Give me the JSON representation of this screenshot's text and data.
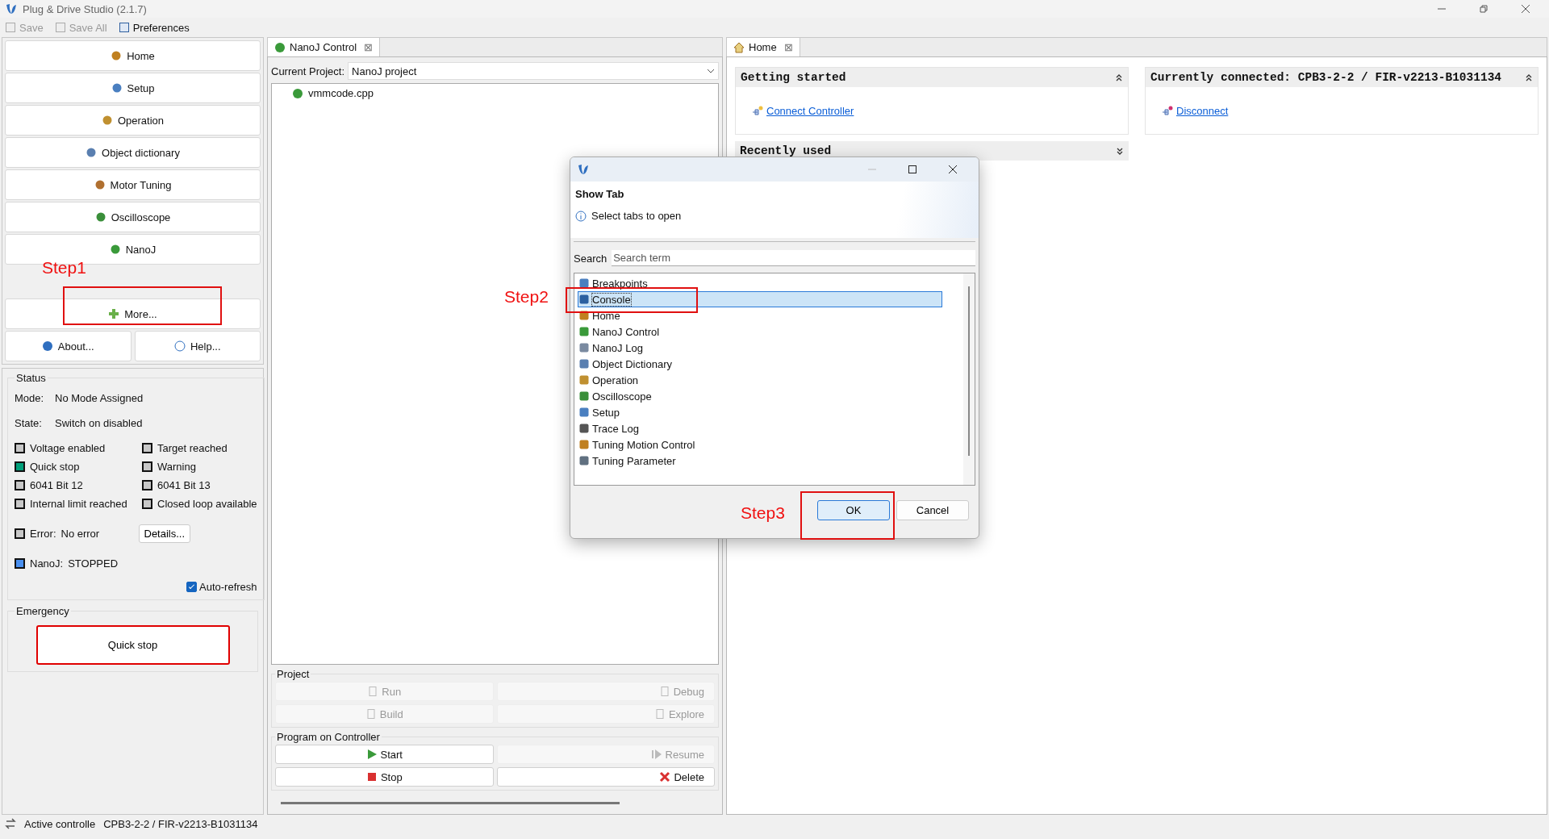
{
  "window": {
    "title": "Plug & Drive Studio (2.1.7)"
  },
  "toolbar": [
    {
      "label": "Save",
      "disabled": true
    },
    {
      "label": "Save All",
      "disabled": true
    },
    {
      "label": "Preferences",
      "disabled": false
    }
  ],
  "sidebar": {
    "nav": [
      {
        "label": "Home"
      },
      {
        "label": "Setup"
      },
      {
        "label": "Operation"
      },
      {
        "label": "Object dictionary"
      },
      {
        "label": "Motor Tuning"
      },
      {
        "label": "Oscilloscope"
      },
      {
        "label": "NanoJ"
      }
    ],
    "more": {
      "label": "More..."
    },
    "about": {
      "label": "About..."
    },
    "help": {
      "label": "Help..."
    },
    "status": {
      "title": "Status",
      "mode_label": "Mode:",
      "mode": "No Mode Assigned",
      "state_label": "State:",
      "state": "Switch on disabled",
      "indicators": [
        {
          "label": "Voltage enabled",
          "color": "#c8c8c8"
        },
        {
          "label": "Target reached",
          "color": "#c8c8c8"
        },
        {
          "label": "Quick stop",
          "color": "#00a07a"
        },
        {
          "label": "Warning",
          "color": "#c8c8c8"
        },
        {
          "label": "6041 Bit 12",
          "color": "#c8c8c8"
        },
        {
          "label": "6041 Bit 13",
          "color": "#c8c8c8"
        },
        {
          "label": "Internal limit reached",
          "color": "#c8c8c8"
        },
        {
          "label": "Closed loop available",
          "color": "#c8c8c8"
        }
      ],
      "error": {
        "label": "Error:",
        "value": "No error",
        "color": "#c8c8c8",
        "button": "Details..."
      },
      "nanoj": {
        "label": "NanoJ:",
        "value": "STOPPED",
        "color": "#4a90f0"
      },
      "auto_refresh": {
        "label": "Auto-refresh",
        "checked": true
      }
    },
    "emergency": {
      "title": "Emergency",
      "button": "Quick stop"
    }
  },
  "nanoj_panel": {
    "tab": {
      "label": "NanoJ Control",
      "close": "⊠"
    },
    "project_label": "Current Project:",
    "project": "NanoJ project",
    "files": [
      {
        "name": "vmmcode.cpp"
      }
    ],
    "project_group": {
      "title": "Project",
      "buttons": [
        {
          "label": "Run",
          "disabled": true
        },
        {
          "label": "Debug",
          "disabled": true
        },
        {
          "label": "Build",
          "disabled": true
        },
        {
          "label": "Explore",
          "disabled": true
        }
      ]
    },
    "controller_group": {
      "title": "Program on Controller",
      "buttons": [
        {
          "label": "Start",
          "disabled": false
        },
        {
          "label": "Resume",
          "disabled": true
        },
        {
          "label": "Stop",
          "disabled": false
        },
        {
          "label": "Delete",
          "disabled": false
        }
      ]
    }
  },
  "home_panel": {
    "tab": {
      "label": "Home",
      "close": "⊠"
    },
    "sections": [
      {
        "title": "Getting started",
        "expanded": true,
        "link": "Connect Controller"
      },
      {
        "title": "Currently connected: CPB3-2-2 / FIR-v2213-B1031134",
        "expanded": true,
        "link": "Disconnect"
      },
      {
        "title": "Recently used",
        "expanded": false
      }
    ]
  },
  "status_bar": {
    "label": "Active controlle",
    "value": "CPB3-2-2 / FIR-v2213-B1031134"
  },
  "dialog": {
    "title": "Show Tab",
    "message": "Select tabs to open",
    "search_label": "Search",
    "search_placeholder": "Search term",
    "items": [
      {
        "label": "Breakpoints",
        "selected": false
      },
      {
        "label": "Console",
        "selected": true
      },
      {
        "label": "Home",
        "selected": false
      },
      {
        "label": "NanoJ Control",
        "selected": false
      },
      {
        "label": "NanoJ Log",
        "selected": false
      },
      {
        "label": "Object Dictionary",
        "selected": false
      },
      {
        "label": "Operation",
        "selected": false
      },
      {
        "label": "Oscilloscope",
        "selected": false
      },
      {
        "label": "Setup",
        "selected": false
      },
      {
        "label": "Trace Log",
        "selected": false
      },
      {
        "label": "Tuning Motion Control",
        "selected": false
      },
      {
        "label": "Tuning Parameter",
        "selected": false
      }
    ],
    "buttons": [
      {
        "label": "OK",
        "default": true
      },
      {
        "label": "Cancel",
        "default": false
      }
    ]
  },
  "annotations": [
    {
      "label": "Step1"
    },
    {
      "label": "Step2"
    },
    {
      "label": "Step3"
    }
  ]
}
